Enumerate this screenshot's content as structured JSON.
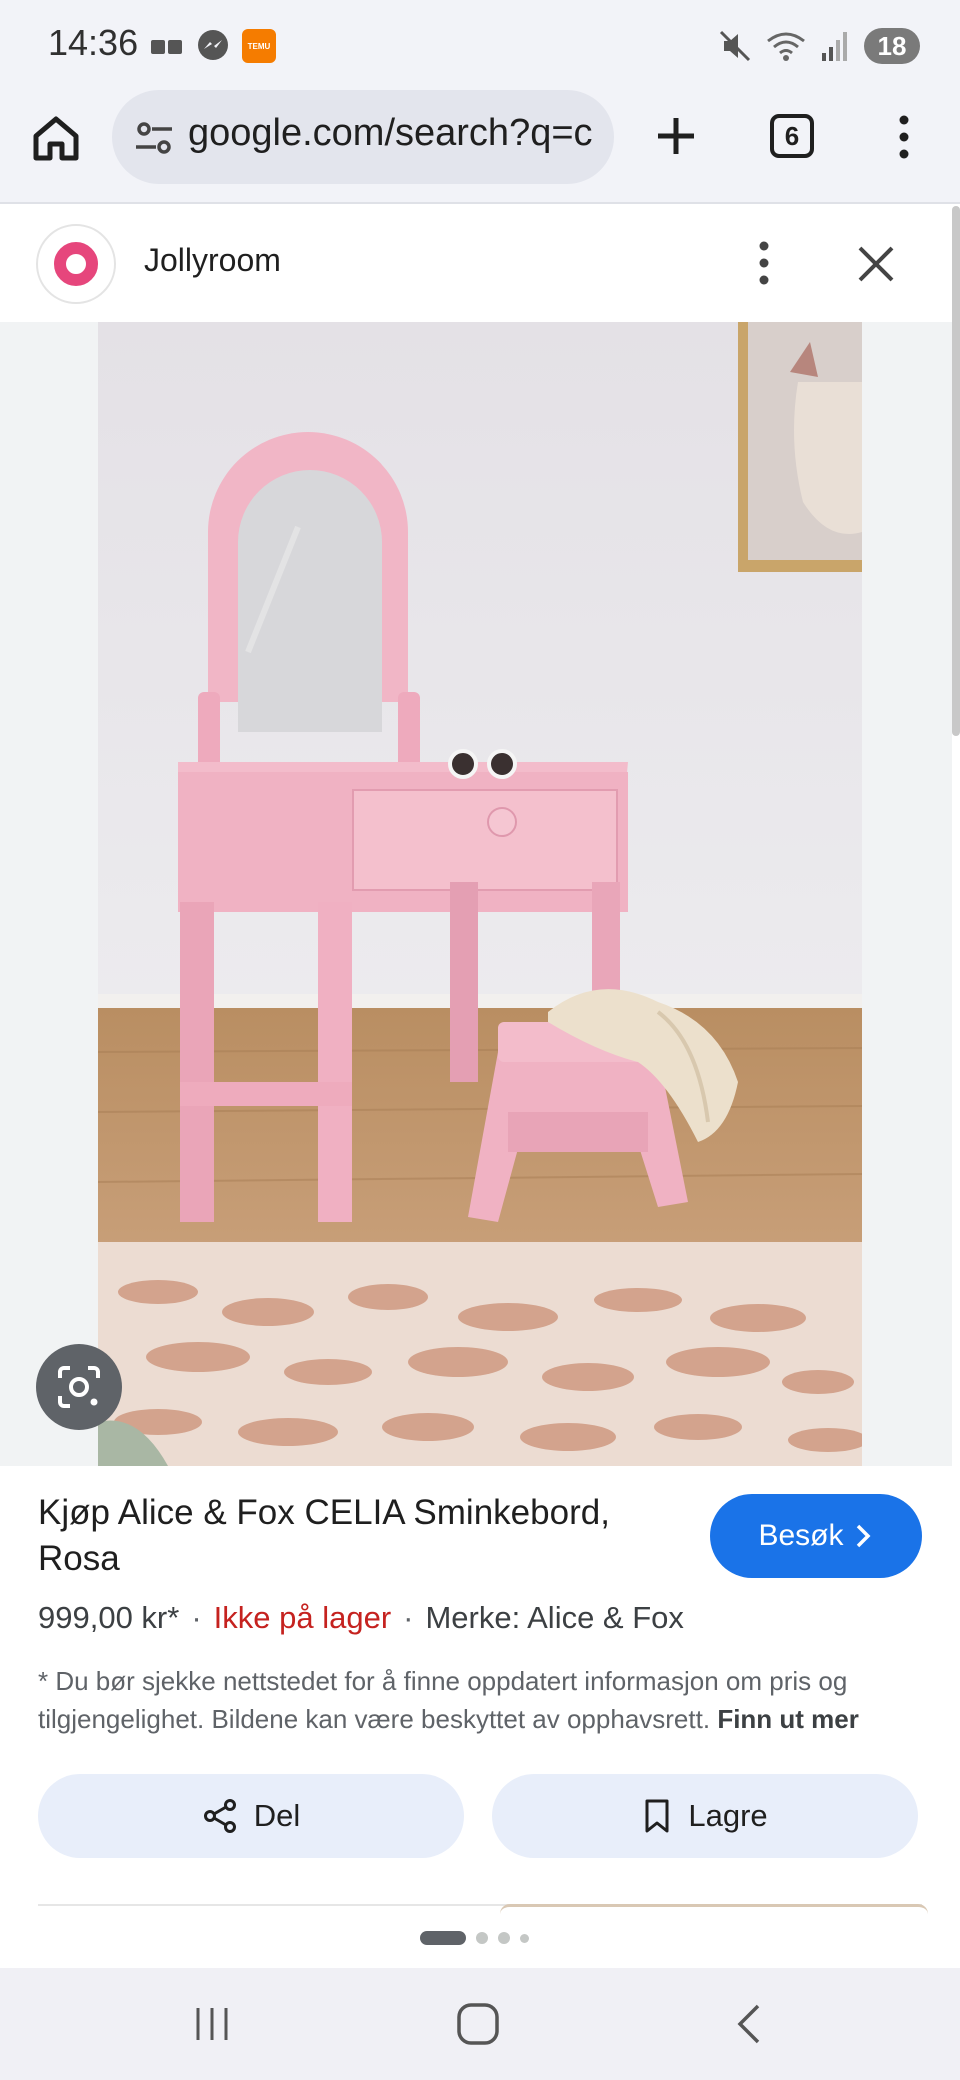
{
  "status_bar": {
    "time": "14:36",
    "notification_icons": [
      "sim-cards-icon",
      "messenger-icon",
      "temu-app-icon"
    ],
    "temu_label": "TEMU",
    "system_icons": [
      "mute-icon",
      "wifi-6e-icon",
      "signal-icon"
    ],
    "battery": "18"
  },
  "browser": {
    "url": "google.com/search?q=c",
    "tab_count": "6"
  },
  "sheet": {
    "site_name": "Jollyroom"
  },
  "product": {
    "title": "Kjøp Alice & Fox CELIA Sminkebord, Rosa",
    "visit_label": "Besøk",
    "price": "999,00 kr*",
    "separator": "·",
    "stock": "Ikke på lager",
    "brand": "Merke: Alice & Fox",
    "disclaimer": "* Du bør sjekke nettstedet for å finne oppdatert informasjon om pris og tilgjengelighet. Bildene kan være beskyttet av opphavsrett.",
    "learn_more": "Finn ut mer",
    "share_label": "Del",
    "save_label": "Lagre"
  },
  "carousel": {
    "page_count": 4,
    "active_index": 0
  },
  "colors": {
    "accent": "#1a73e8",
    "out_of_stock": "#c5221f",
    "brand_logo": "#e6467c",
    "chip_background": "#e8eefa"
  }
}
